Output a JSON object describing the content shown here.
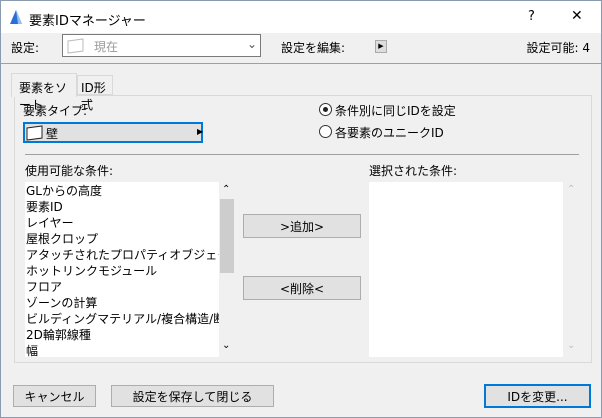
{
  "window": {
    "title": "要素IDマネージャー",
    "help": "?",
    "close": "✕"
  },
  "settings": {
    "label": "設定:",
    "value": "現在",
    "edit_label": "設定を編集:",
    "available": "設定可能: 4"
  },
  "tabs": [
    {
      "label": "要素をソート"
    },
    {
      "label": "ID形式"
    }
  ],
  "element_type": {
    "label": "要素タイプ:",
    "value": "壁"
  },
  "radios": [
    {
      "label": "条件別に同じIDを設定",
      "checked": true
    },
    {
      "label": "各要素のユニークID",
      "checked": false
    }
  ],
  "available": {
    "label": "使用可能な条件:",
    "items": [
      "GLからの高度",
      "要素ID",
      "レイヤー",
      "屋根クロップ",
      "アタッチされたプロパティオブジェクト名",
      "ホットリンクモジュール",
      "フロア",
      "ゾーンの計算",
      "ビルディングマテリアル/複合構造/断面...",
      "2D輪郭線種",
      "幅"
    ]
  },
  "selected": {
    "label": "選択された条件:"
  },
  "buttons": {
    "add": ">追加>",
    "remove": "<削除<",
    "cancel": "キャンセル",
    "save_close": "設定を保存して閉じる",
    "change_id": "IDを変更..."
  }
}
